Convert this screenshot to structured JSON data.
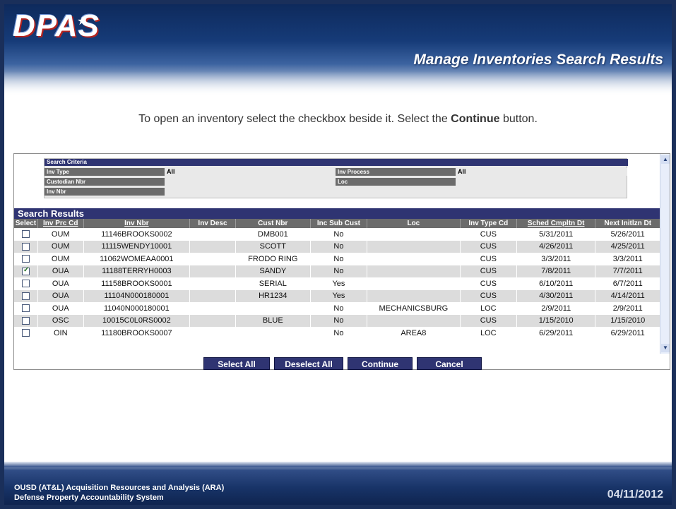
{
  "header": {
    "logo_text": "DPAS",
    "title": "Manage Inventories Search Results"
  },
  "instruction": {
    "prefix": "To open an inventory select the checkbox beside it. Select the",
    "bold": "Continue",
    "suffix": "button."
  },
  "criteria": {
    "heading": "Search Criteria",
    "inv_type_label": "Inv Type",
    "inv_type_value": "All",
    "inv_process_label": "Inv Process",
    "inv_process_value": "All",
    "custodian_label": "Custodian Nbr",
    "loc_label": "Loc",
    "inv_nbr_label": "Inv Nbr"
  },
  "results": {
    "heading": "Search Results",
    "columns": [
      "Select",
      "Inv Prc Cd",
      "Inv Nbr",
      "Inv Desc",
      "Cust Nbr",
      "Inc Sub Cust",
      "Loc",
      "Inv Type Cd",
      "Sched Cmpltn Dt",
      "Next Initlzn Dt"
    ],
    "rows": [
      {
        "checked": false,
        "prc": "OUM",
        "inv": "11146BROOKS0002",
        "desc": "",
        "cust": "DMB001",
        "sub": "No",
        "loc": "",
        "type": "CUS",
        "sched": "5/31/2011",
        "next": "5/26/2011"
      },
      {
        "checked": false,
        "prc": "OUM",
        "inv": "11115WENDY10001",
        "desc": "",
        "cust": "SCOTT",
        "sub": "No",
        "loc": "",
        "type": "CUS",
        "sched": "4/26/2011",
        "next": "4/25/2011"
      },
      {
        "checked": false,
        "prc": "OUM",
        "inv": "11062WOMEAA0001",
        "desc": "",
        "cust": "FRODO RING",
        "sub": "No",
        "loc": "",
        "type": "CUS",
        "sched": "3/3/2011",
        "next": "3/3/2011"
      },
      {
        "checked": true,
        "prc": "OUA",
        "inv": "11188TERRYH0003",
        "desc": "",
        "cust": "SANDY",
        "sub": "No",
        "loc": "",
        "type": "CUS",
        "sched": "7/8/2011",
        "next": "7/7/2011"
      },
      {
        "checked": false,
        "prc": "OUA",
        "inv": "11158BROOKS0001",
        "desc": "",
        "cust": "SERIAL",
        "sub": "Yes",
        "loc": "",
        "type": "CUS",
        "sched": "6/10/2011",
        "next": "6/7/2011"
      },
      {
        "checked": false,
        "prc": "OUA",
        "inv": "11104N000180001",
        "desc": "",
        "cust": "HR1234",
        "sub": "Yes",
        "loc": "",
        "type": "CUS",
        "sched": "4/30/2011",
        "next": "4/14/2011"
      },
      {
        "checked": false,
        "prc": "OUA",
        "inv": "11040N000180001",
        "desc": "",
        "cust": "",
        "sub": "No",
        "loc": "MECHANICSBURG",
        "type": "LOC",
        "sched": "2/9/2011",
        "next": "2/9/2011"
      },
      {
        "checked": false,
        "prc": "OSC",
        "inv": "10015C0L0RS0002",
        "desc": "",
        "cust": "BLUE",
        "sub": "No",
        "loc": "",
        "type": "CUS",
        "sched": "1/15/2010",
        "next": "1/15/2010"
      },
      {
        "checked": false,
        "prc": "OIN",
        "inv": "11180BROOKS0007",
        "desc": "",
        "cust": "",
        "sub": "No",
        "loc": "AREA8",
        "type": "LOC",
        "sched": "6/29/2011",
        "next": "6/29/2011"
      }
    ]
  },
  "buttons": {
    "select_all": "Select All",
    "deselect_all": "Deselect All",
    "continue": "Continue",
    "cancel": "Cancel"
  },
  "footer": {
    "org_line1": "OUSD (AT&L) Acquisition Resources and Analysis (ARA)",
    "org_line2": "Defense Property Accountability System",
    "date": "04/11/2012"
  },
  "colors": {
    "navy": "#2f3472",
    "header_gray": "#6b6b6b",
    "row_alt": "#dcdcdc"
  }
}
